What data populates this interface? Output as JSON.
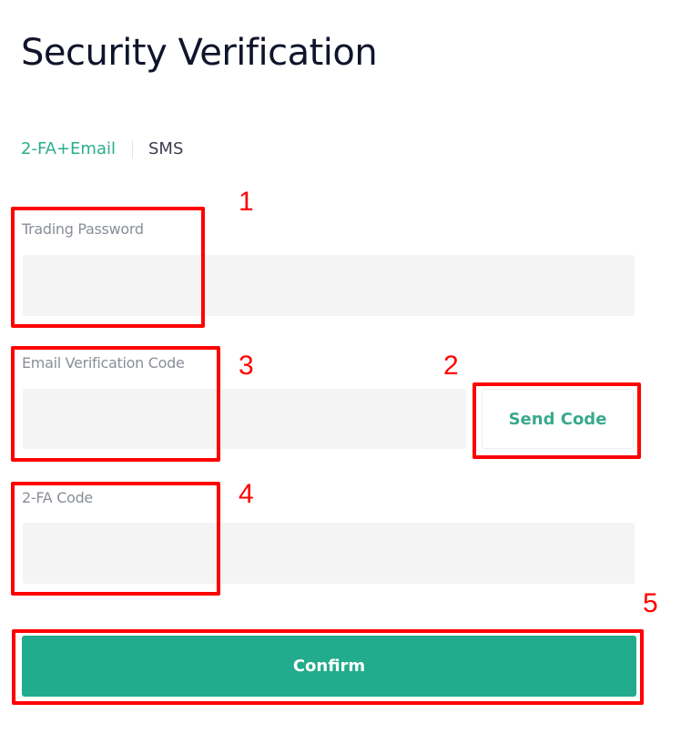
{
  "page": {
    "title": "Security Verification"
  },
  "tabs": [
    {
      "label": "2-FA+Email",
      "active": true
    },
    {
      "label": "SMS",
      "active": false
    }
  ],
  "form": {
    "trading_password": {
      "label": "Trading Password",
      "value": "",
      "placeholder": ""
    },
    "email_code": {
      "label": "Email Verification Code",
      "value": "",
      "placeholder": ""
    },
    "send_code_label": "Send Code",
    "twofa_code": {
      "label": "2-FA Code",
      "value": "",
      "placeholder": ""
    },
    "confirm_label": "Confirm"
  },
  "annotations": {
    "step1": "1",
    "step2": "2",
    "step3": "3",
    "step4": "4",
    "step5": "5",
    "color": "#ff0000"
  },
  "colors": {
    "accent": "#22ab8c",
    "accent_text": "#2aae8c",
    "input_bg": "#f4f4f4",
    "title": "#10142b"
  }
}
